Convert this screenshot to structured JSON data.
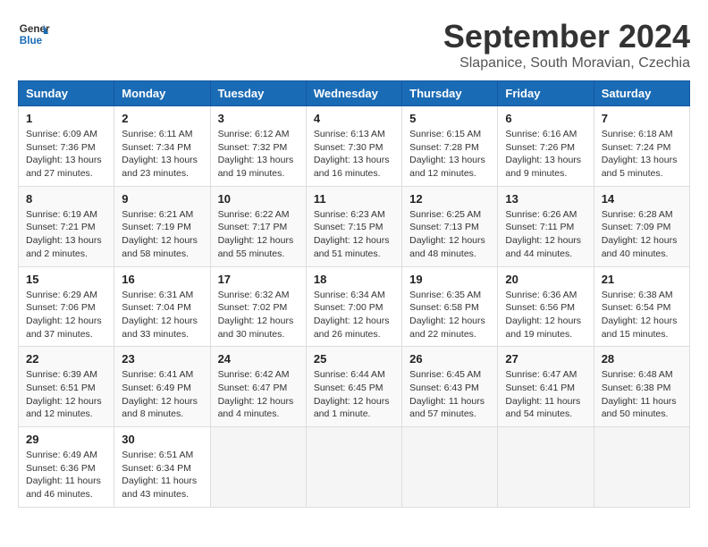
{
  "header": {
    "logo_line1": "General",
    "logo_line2": "Blue",
    "title": "September 2024",
    "subtitle": "Slapanice, South Moravian, Czechia"
  },
  "weekdays": [
    "Sunday",
    "Monday",
    "Tuesday",
    "Wednesday",
    "Thursday",
    "Friday",
    "Saturday"
  ],
  "weeks": [
    [
      {
        "day": "1",
        "info": "Sunrise: 6:09 AM\nSunset: 7:36 PM\nDaylight: 13 hours\nand 27 minutes."
      },
      {
        "day": "2",
        "info": "Sunrise: 6:11 AM\nSunset: 7:34 PM\nDaylight: 13 hours\nand 23 minutes."
      },
      {
        "day": "3",
        "info": "Sunrise: 6:12 AM\nSunset: 7:32 PM\nDaylight: 13 hours\nand 19 minutes."
      },
      {
        "day": "4",
        "info": "Sunrise: 6:13 AM\nSunset: 7:30 PM\nDaylight: 13 hours\nand 16 minutes."
      },
      {
        "day": "5",
        "info": "Sunrise: 6:15 AM\nSunset: 7:28 PM\nDaylight: 13 hours\nand 12 minutes."
      },
      {
        "day": "6",
        "info": "Sunrise: 6:16 AM\nSunset: 7:26 PM\nDaylight: 13 hours\nand 9 minutes."
      },
      {
        "day": "7",
        "info": "Sunrise: 6:18 AM\nSunset: 7:24 PM\nDaylight: 13 hours\nand 5 minutes."
      }
    ],
    [
      {
        "day": "8",
        "info": "Sunrise: 6:19 AM\nSunset: 7:21 PM\nDaylight: 13 hours\nand 2 minutes."
      },
      {
        "day": "9",
        "info": "Sunrise: 6:21 AM\nSunset: 7:19 PM\nDaylight: 12 hours\nand 58 minutes."
      },
      {
        "day": "10",
        "info": "Sunrise: 6:22 AM\nSunset: 7:17 PM\nDaylight: 12 hours\nand 55 minutes."
      },
      {
        "day": "11",
        "info": "Sunrise: 6:23 AM\nSunset: 7:15 PM\nDaylight: 12 hours\nand 51 minutes."
      },
      {
        "day": "12",
        "info": "Sunrise: 6:25 AM\nSunset: 7:13 PM\nDaylight: 12 hours\nand 48 minutes."
      },
      {
        "day": "13",
        "info": "Sunrise: 6:26 AM\nSunset: 7:11 PM\nDaylight: 12 hours\nand 44 minutes."
      },
      {
        "day": "14",
        "info": "Sunrise: 6:28 AM\nSunset: 7:09 PM\nDaylight: 12 hours\nand 40 minutes."
      }
    ],
    [
      {
        "day": "15",
        "info": "Sunrise: 6:29 AM\nSunset: 7:06 PM\nDaylight: 12 hours\nand 37 minutes."
      },
      {
        "day": "16",
        "info": "Sunrise: 6:31 AM\nSunset: 7:04 PM\nDaylight: 12 hours\nand 33 minutes."
      },
      {
        "day": "17",
        "info": "Sunrise: 6:32 AM\nSunset: 7:02 PM\nDaylight: 12 hours\nand 30 minutes."
      },
      {
        "day": "18",
        "info": "Sunrise: 6:34 AM\nSunset: 7:00 PM\nDaylight: 12 hours\nand 26 minutes."
      },
      {
        "day": "19",
        "info": "Sunrise: 6:35 AM\nSunset: 6:58 PM\nDaylight: 12 hours\nand 22 minutes."
      },
      {
        "day": "20",
        "info": "Sunrise: 6:36 AM\nSunset: 6:56 PM\nDaylight: 12 hours\nand 19 minutes."
      },
      {
        "day": "21",
        "info": "Sunrise: 6:38 AM\nSunset: 6:54 PM\nDaylight: 12 hours\nand 15 minutes."
      }
    ],
    [
      {
        "day": "22",
        "info": "Sunrise: 6:39 AM\nSunset: 6:51 PM\nDaylight: 12 hours\nand 12 minutes."
      },
      {
        "day": "23",
        "info": "Sunrise: 6:41 AM\nSunset: 6:49 PM\nDaylight: 12 hours\nand 8 minutes."
      },
      {
        "day": "24",
        "info": "Sunrise: 6:42 AM\nSunset: 6:47 PM\nDaylight: 12 hours\nand 4 minutes."
      },
      {
        "day": "25",
        "info": "Sunrise: 6:44 AM\nSunset: 6:45 PM\nDaylight: 12 hours\nand 1 minute."
      },
      {
        "day": "26",
        "info": "Sunrise: 6:45 AM\nSunset: 6:43 PM\nDaylight: 11 hours\nand 57 minutes."
      },
      {
        "day": "27",
        "info": "Sunrise: 6:47 AM\nSunset: 6:41 PM\nDaylight: 11 hours\nand 54 minutes."
      },
      {
        "day": "28",
        "info": "Sunrise: 6:48 AM\nSunset: 6:38 PM\nDaylight: 11 hours\nand 50 minutes."
      }
    ],
    [
      {
        "day": "29",
        "info": "Sunrise: 6:49 AM\nSunset: 6:36 PM\nDaylight: 11 hours\nand 46 minutes."
      },
      {
        "day": "30",
        "info": "Sunrise: 6:51 AM\nSunset: 6:34 PM\nDaylight: 11 hours\nand 43 minutes."
      },
      {
        "day": "",
        "info": ""
      },
      {
        "day": "",
        "info": ""
      },
      {
        "day": "",
        "info": ""
      },
      {
        "day": "",
        "info": ""
      },
      {
        "day": "",
        "info": ""
      }
    ]
  ]
}
